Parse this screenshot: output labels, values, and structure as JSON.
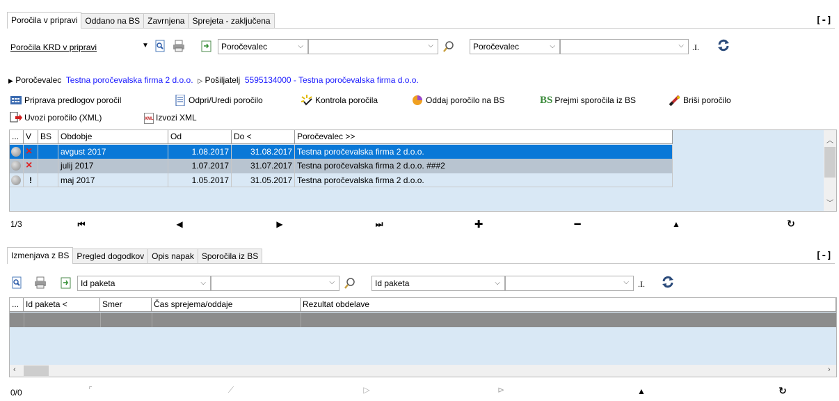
{
  "top_tabs": [
    "Poročila v pripravi",
    "Oddano na BS",
    "Zavrnjena",
    "Sprejeta - zaključena"
  ],
  "collapse_label": "[-]",
  "toolbar1": {
    "report_menu": "Poročila KRD v pripravi",
    "filter1_select": "Poročevalec",
    "filter2_select": "Poročevalec",
    "clear_label": ".I."
  },
  "breadcrumb": {
    "label1": "Poročevalec",
    "value1": "Testna poročevalska firma 2 d.o.o.",
    "label2": "Pošiljatelj",
    "value2": "5595134000 - Testna poročevalska firma d.o.o."
  },
  "actions": [
    "Priprava predlogov poročil",
    "Odpri/Uredi poročilo",
    "Kontrola poročila",
    "Oddaj poročilo na BS",
    "Prejmi sporočila iz BS",
    "Briši poročilo",
    "Uvozi poročilo (XML)",
    "Izvozi XML"
  ],
  "bs_icon_text": "BS",
  "xml_icon_text": "XML",
  "grid1": {
    "headers": [
      "...",
      "V",
      "BS",
      "Obdobje",
      "Od",
      "Do <",
      "Poročevalec >>"
    ],
    "rows": [
      {
        "v": "×",
        "period": "avgust 2017",
        "from": "1.08.2017",
        "to": "31.08.2017",
        "reporter": "Testna poročevalska firma 2 d.o.o."
      },
      {
        "v": "×",
        "period": "julij 2017",
        "from": "1.07.2017",
        "to": "31.07.2017",
        "reporter": "Testna poročevalska firma 2 d.o.o. ###2"
      },
      {
        "v": "!",
        "period": "maj 2017",
        "from": "1.05.2017",
        "to": "31.05.2017",
        "reporter": "Testna poročevalska firma 2 d.o.o."
      }
    ]
  },
  "nav1": {
    "position": "1/3"
  },
  "bottom_tabs": [
    "Izmenjava z BS",
    "Pregled dogodkov",
    "Opis napak",
    "Sporočila iz BS"
  ],
  "toolbar2": {
    "filter1_select": "Id paketa",
    "filter2_select": "Id paketa",
    "clear_label": ".I."
  },
  "grid2": {
    "headers": [
      "...",
      "Id paketa <",
      "Smer",
      "Čas sprejema/oddaje",
      "Rezultat obdelave"
    ]
  },
  "nav2": {
    "position": "0/0"
  },
  "colors": {
    "selected_row": "#0a78d7",
    "grid_bg": "#d9e8f5",
    "link": "#1a1aff"
  }
}
